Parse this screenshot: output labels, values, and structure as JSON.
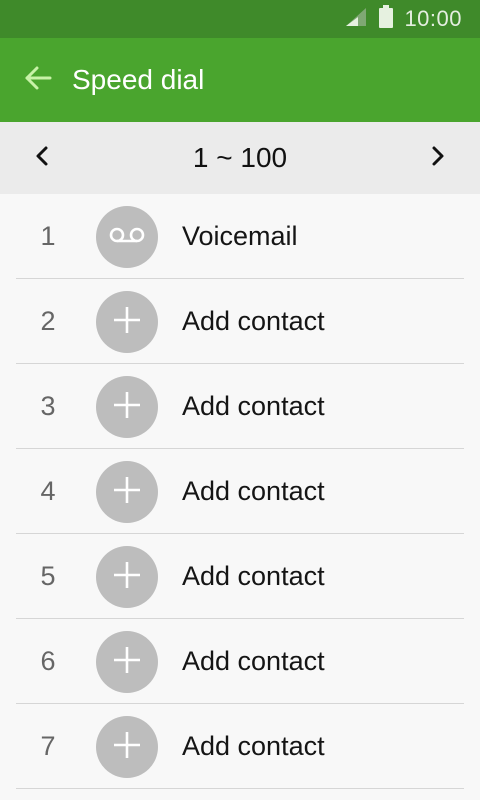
{
  "status_bar": {
    "time": "10:00",
    "signal_icon": "signal-icon",
    "battery_icon": "battery-icon"
  },
  "app_bar": {
    "title": "Speed dial",
    "back_icon": "back-arrow-icon"
  },
  "range": {
    "text": "1 ~ 100",
    "prev_icon": "chevron-left-icon",
    "next_icon": "chevron-right-icon"
  },
  "colors": {
    "status_bar": "#3f8a2a",
    "app_bar": "#4aa52e",
    "avatar": "#bdbdbd"
  },
  "entries": [
    {
      "number": "1",
      "label": "Voicemail",
      "icon": "voicemail-icon"
    },
    {
      "number": "2",
      "label": "Add contact",
      "icon": "plus-icon"
    },
    {
      "number": "3",
      "label": "Add contact",
      "icon": "plus-icon"
    },
    {
      "number": "4",
      "label": "Add contact",
      "icon": "plus-icon"
    },
    {
      "number": "5",
      "label": "Add contact",
      "icon": "plus-icon"
    },
    {
      "number": "6",
      "label": "Add contact",
      "icon": "plus-icon"
    },
    {
      "number": "7",
      "label": "Add contact",
      "icon": "plus-icon"
    }
  ]
}
